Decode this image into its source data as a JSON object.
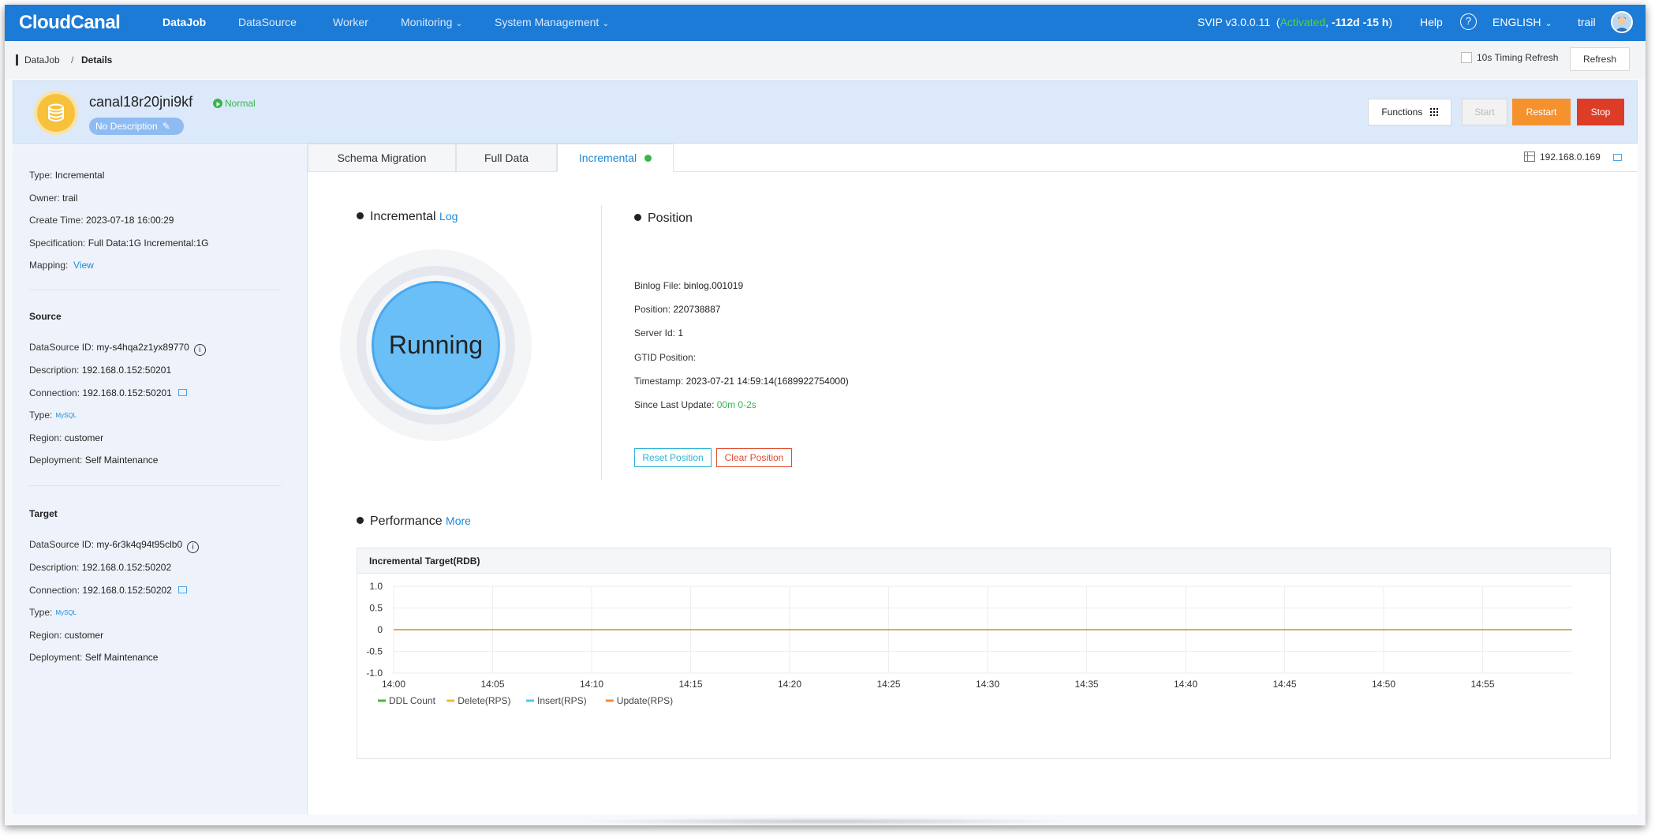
{
  "topnav": {
    "logo": "CloudCanal",
    "items": [
      "DataJob",
      "DataSource",
      "Worker",
      "Monitoring",
      "System Management"
    ],
    "version": "SVIP v3.0.0.11",
    "activated": "Activated",
    "remaining": "-112d -15 h",
    "help": "Help",
    "help_icon": "question-icon",
    "language": "ENGLISH",
    "user": "trail"
  },
  "breadcrumb": {
    "root": "DataJob",
    "separator": "/",
    "current": "Details"
  },
  "toolbar": {
    "timing_label": "10s Timing Refresh",
    "timing_checked": false,
    "refresh_label": "Refresh"
  },
  "job": {
    "name": "canal18r20jni9kf",
    "status": "Normal",
    "description": "No Description",
    "buttons": {
      "functions": "Functions",
      "start": "Start",
      "restart": "Restart",
      "stop": "Stop"
    }
  },
  "info": {
    "type_label": "Type:",
    "type": "Incremental",
    "owner_label": "Owner:",
    "owner": "trail",
    "create_label": "Create Time:",
    "create_time": "2023-07-18 16:00:29",
    "spec_label": "Specification:",
    "spec": "Full Data:1G Incremental:1G",
    "mapping_label": "Mapping:",
    "mapping_link": "View"
  },
  "source": {
    "heading": "Source",
    "id_label": "DataSource ID:",
    "id": "my-s4hqa2z1yx89770",
    "desc_label": "Description:",
    "desc": "192.168.0.152:50201",
    "conn_label": "Connection:",
    "conn": "192.168.0.152:50201",
    "type_label": "Type:",
    "type_icon": "MySQL",
    "region_label": "Region:",
    "region": "customer",
    "deploy_label": "Deployment:",
    "deploy": "Self Maintenance"
  },
  "target": {
    "heading": "Target",
    "id_label": "DataSource ID:",
    "id": "my-6r3k4q94t95clb0",
    "desc_label": "Description:",
    "desc": "192.168.0.152:50202",
    "conn_label": "Connection:",
    "conn": "192.168.0.152:50202",
    "type_label": "Type:",
    "type_icon": "MySQL",
    "region_label": "Region:",
    "region": "customer",
    "deploy_label": "Deployment:",
    "deploy": "Self Maintenance"
  },
  "tabs": [
    "Schema Migration",
    "Full Data",
    "Incremental"
  ],
  "worker_ip": "192.168.0.169",
  "incremental": {
    "title": "Incremental",
    "log_link": "Log",
    "state": "Running"
  },
  "position": {
    "title": "Position",
    "binlog_label": "Binlog File:",
    "binlog": "binlog.001019",
    "pos_label": "Position:",
    "pos": "220738887",
    "server_label": "Server Id:",
    "server": "1",
    "gtid_label": "GTID Position:",
    "gtid": "",
    "ts_label": "Timestamp:",
    "ts": "2023-07-21 14:59:14(1689922754000)",
    "since_label": "Since Last Update:",
    "since": "00m 0-2s",
    "reset_btn": "Reset Position",
    "clear_btn": "Clear Position"
  },
  "performance": {
    "title": "Performance",
    "more_link": "More"
  },
  "chart_data": {
    "type": "line",
    "title": "Incremental Target(RDB)",
    "xlabel": "",
    "ylabel": "",
    "x": [
      "14:00",
      "14:05",
      "14:10",
      "14:15",
      "14:20",
      "14:25",
      "14:30",
      "14:35",
      "14:40",
      "14:45",
      "14:50",
      "14:55"
    ],
    "ylim": [
      -1.0,
      1.0
    ],
    "yticks": [
      "1.0",
      "0.5",
      "0",
      "-0.5",
      "-1.0"
    ],
    "grid": true,
    "legend_position": "bottom-left",
    "series": [
      {
        "name": "DDL Count",
        "color": "#52b043",
        "values": [
          0,
          0,
          0,
          0,
          0,
          0,
          0,
          0,
          0,
          0,
          0,
          0,
          0
        ]
      },
      {
        "name": "Delete(RPS)",
        "color": "#f4b73a",
        "values": [
          0,
          0,
          0,
          0,
          0,
          0,
          0,
          0,
          0,
          0,
          0,
          0,
          0
        ]
      },
      {
        "name": "Insert(RPS)",
        "color": "#53c7e8",
        "values": [
          0,
          0,
          0,
          0,
          0,
          0,
          0,
          0,
          0,
          0,
          0,
          0,
          0
        ]
      },
      {
        "name": "Update(RPS)",
        "color": "#f08a3c",
        "values": [
          0,
          0,
          0,
          0,
          0,
          0,
          0,
          0,
          0,
          0,
          0,
          0,
          0
        ]
      }
    ]
  }
}
